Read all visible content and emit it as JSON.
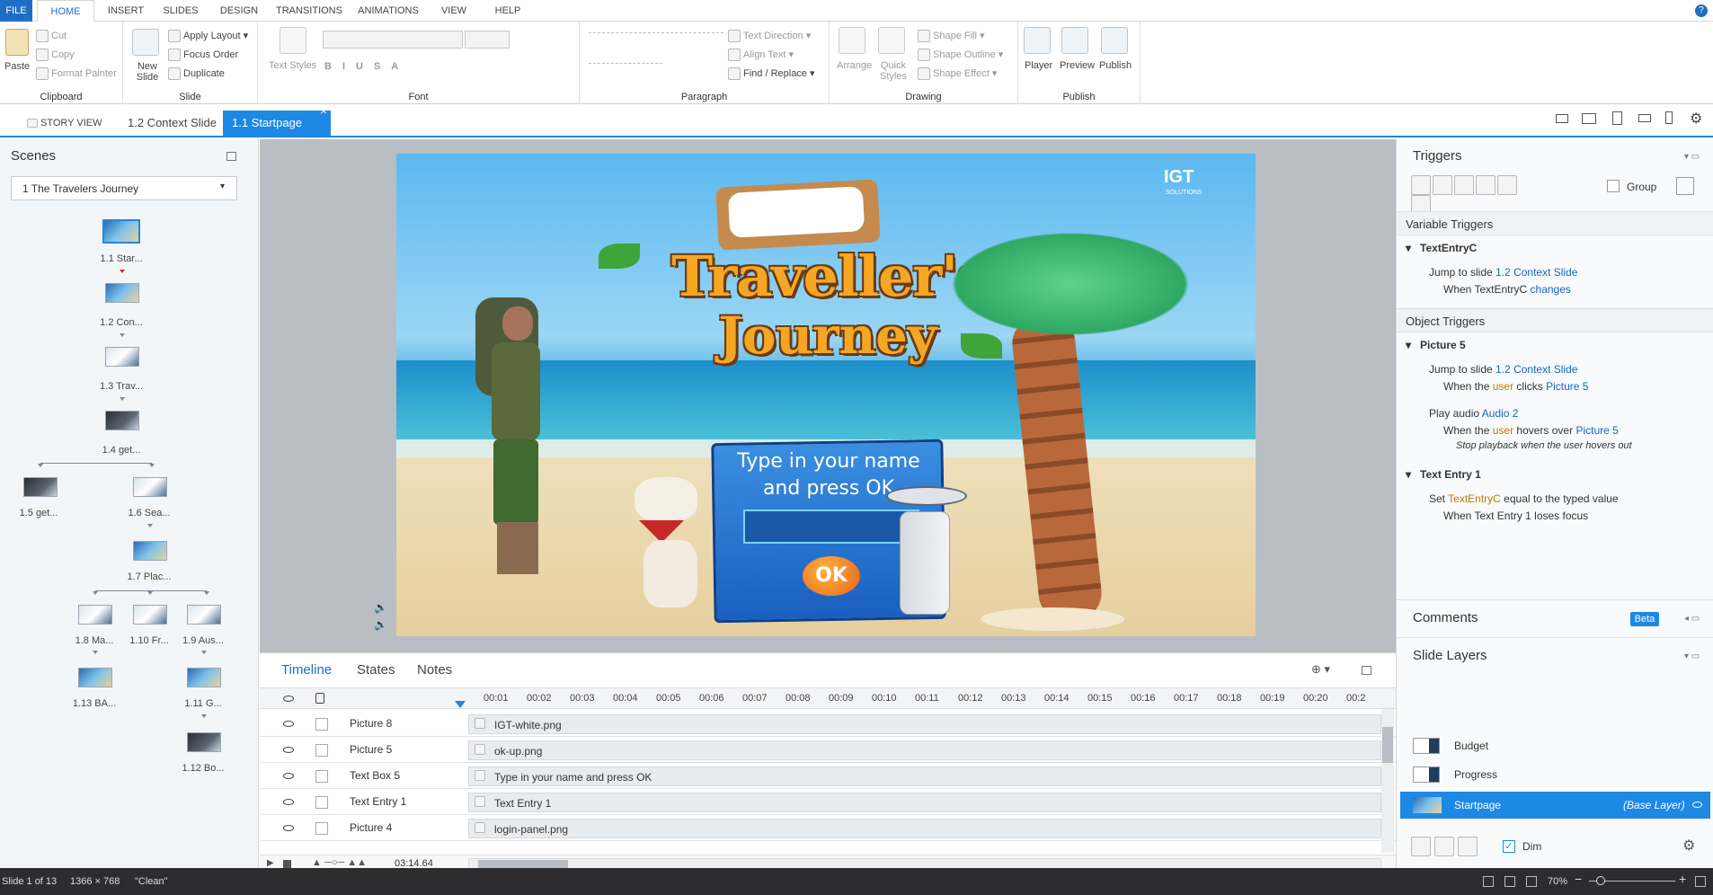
{
  "menu": {
    "file": "FILE",
    "tabs": [
      "HOME",
      "INSERT",
      "SLIDES",
      "DESIGN",
      "TRANSITIONS",
      "ANIMATIONS",
      "VIEW",
      "HELP"
    ]
  },
  "ribbon": {
    "clipboard": {
      "paste": "Paste",
      "cut": "Cut",
      "copy": "Copy",
      "format_painter": "Format Painter",
      "label": "Clipboard"
    },
    "slide": {
      "new_slide": "New\nSlide",
      "apply_layout": "Apply Layout",
      "focus_order": "Focus Order",
      "duplicate": "Duplicate",
      "label": "Slide"
    },
    "font": {
      "text_styles": "Text Styles",
      "label": "Font"
    },
    "paragraph": {
      "text_direction": "Text Direction",
      "align_text": "Align Text",
      "find_replace": "Find / Replace",
      "label": "Paragraph"
    },
    "drawing": {
      "arrange": "Arrange",
      "quick_styles": "Quick\nStyles",
      "shape_fill": "Shape Fill",
      "shape_outline": "Shape Outline",
      "shape_effect": "Shape Effect",
      "label": "Drawing"
    },
    "publish": {
      "player": "Player",
      "preview": "Preview",
      "publish": "Publish",
      "label": "Publish"
    }
  },
  "tabs": {
    "story_view": "STORY VIEW",
    "context_slide": "1.2 Context Slide",
    "startpage": "1.1 Startpage"
  },
  "scenes": {
    "title": "Scenes",
    "selected_scene": "1 The Travelers Journey",
    "slides": [
      {
        "label": "1.1 Star..."
      },
      {
        "label": "1.2 Con..."
      },
      {
        "label": "1.3 Trav..."
      },
      {
        "label": "1.4 get..."
      },
      {
        "label": "1.5 get..."
      },
      {
        "label": "1.6 Sea..."
      },
      {
        "label": "1.7 Plac..."
      },
      {
        "label": "1.8 Ma..."
      },
      {
        "label": "1.10 Fr..."
      },
      {
        "label": "1.9 Aus..."
      },
      {
        "label": "1.13 BA..."
      },
      {
        "label": "1.11 G..."
      },
      {
        "label": "1.12 Bo..."
      }
    ]
  },
  "slide_content": {
    "title_line1": "Traveller's",
    "title_line2": "Journey",
    "logo": "IGT",
    "logo_sub": "SOLUTIONS",
    "prompt_line1": "Type in your name",
    "prompt_line2": "and press OK",
    "ok_button": "OK"
  },
  "timeline": {
    "tabs": [
      "Timeline",
      "States",
      "Notes"
    ],
    "ticks": [
      "00:01",
      "00:02",
      "00:03",
      "00:04",
      "00:05",
      "00:06",
      "00:07",
      "00:08",
      "00:09",
      "00:10",
      "00:11",
      "00:12",
      "00:13",
      "00:14",
      "00:15",
      "00:16",
      "00:17",
      "00:18",
      "00:19",
      "00:20",
      "00:2"
    ],
    "rows": [
      {
        "name": "Picture 8",
        "bar": "IGT-white.png"
      },
      {
        "name": "Picture 5",
        "bar": "ok-up.png"
      },
      {
        "name": "Text Box 5",
        "bar": "Type in your name and press OK"
      },
      {
        "name": "Text Entry 1",
        "bar": "Text Entry 1"
      },
      {
        "name": "Picture 4",
        "bar": "login-panel.png"
      }
    ],
    "duration": "03:14.64"
  },
  "triggers": {
    "title": "Triggers",
    "group_label": "Group",
    "variable_triggers": "Variable Triggers",
    "object_triggers": "Object Triggers",
    "var_items": [
      {
        "owner": "TextEntryC",
        "action": "Jump to slide",
        "target": "1.2 Context Slide",
        "when_prefix": "When",
        "when_obj": "TextEntryC",
        "when_event": "changes"
      }
    ],
    "obj_picture5": "Picture 5",
    "obj_textentry": "Text Entry 1",
    "p5_action1": "Jump to slide",
    "p5_target1": "1.2 Context Slide",
    "p5_when1_a": "When the",
    "p5_when1_b": "user",
    "p5_when1_c": "clicks",
    "p5_when1_d": "Picture 5",
    "p5_action2": "Play audio",
    "p5_target2": "Audio 2",
    "p5_when2_a": "When the",
    "p5_when2_b": "user",
    "p5_when2_c": "hovers over",
    "p5_when2_d": "Picture 5",
    "p5_stop": "Stop playback when the user hovers out",
    "te_action_a": "Set",
    "te_action_var": "TextEntryC",
    "te_action_b": "equal to the typed value",
    "te_when": "When Text Entry 1 loses focus"
  },
  "comments": {
    "title": "Comments",
    "badge": "Beta"
  },
  "layers": {
    "title": "Slide Layers",
    "items": [
      {
        "name": "Budget"
      },
      {
        "name": "Progress"
      }
    ],
    "base": {
      "name": "Startpage",
      "tag": "(Base Layer)"
    },
    "dim": "Dim"
  },
  "status": {
    "slide": "Slide 1 of 13",
    "size": "1366 × 768",
    "state": "\"Clean\"",
    "zoom": "70%"
  }
}
